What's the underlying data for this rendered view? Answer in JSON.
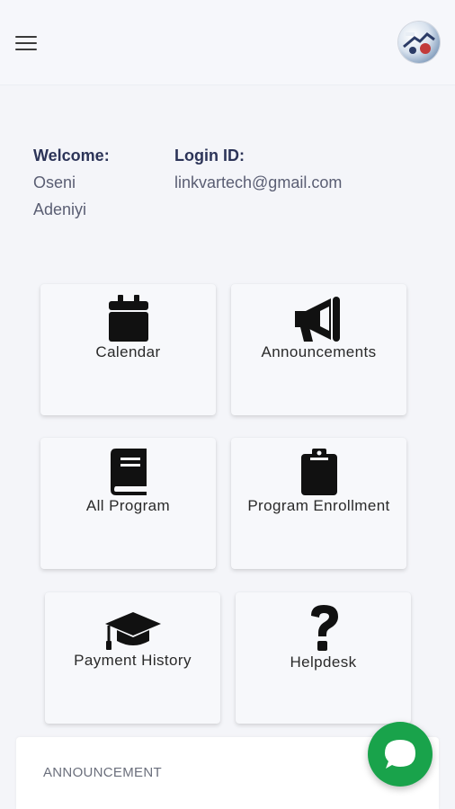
{
  "header": {
    "menu_icon": "hamburger-menu-icon",
    "avatar_icon": "user-avatar"
  },
  "user": {
    "welcome_label": "Welcome:",
    "first_name": "Oseni",
    "last_name": "Adeniyi",
    "login_label": "Login ID:",
    "login_value": "linkvartech@gmail.com"
  },
  "tiles": [
    {
      "label": "Calendar",
      "icon": "calendar-icon"
    },
    {
      "label": "Announcements",
      "icon": "megaphone-icon"
    },
    {
      "label": "All Program",
      "icon": "book-icon"
    },
    {
      "label": "Program Enrollment",
      "icon": "clipboard-icon"
    },
    {
      "label": "Payment History",
      "icon": "graduation-cap-icon"
    },
    {
      "label": "Helpdesk",
      "icon": "question-mark-icon"
    }
  ],
  "announcement_panel": {
    "title": "ANNOUNCEMENT"
  },
  "chat": {
    "icon": "chat-bubble-icon"
  },
  "colors": {
    "background": "#f4f5f9",
    "heading": "#2c3458",
    "chat_button": "#19a34b"
  }
}
